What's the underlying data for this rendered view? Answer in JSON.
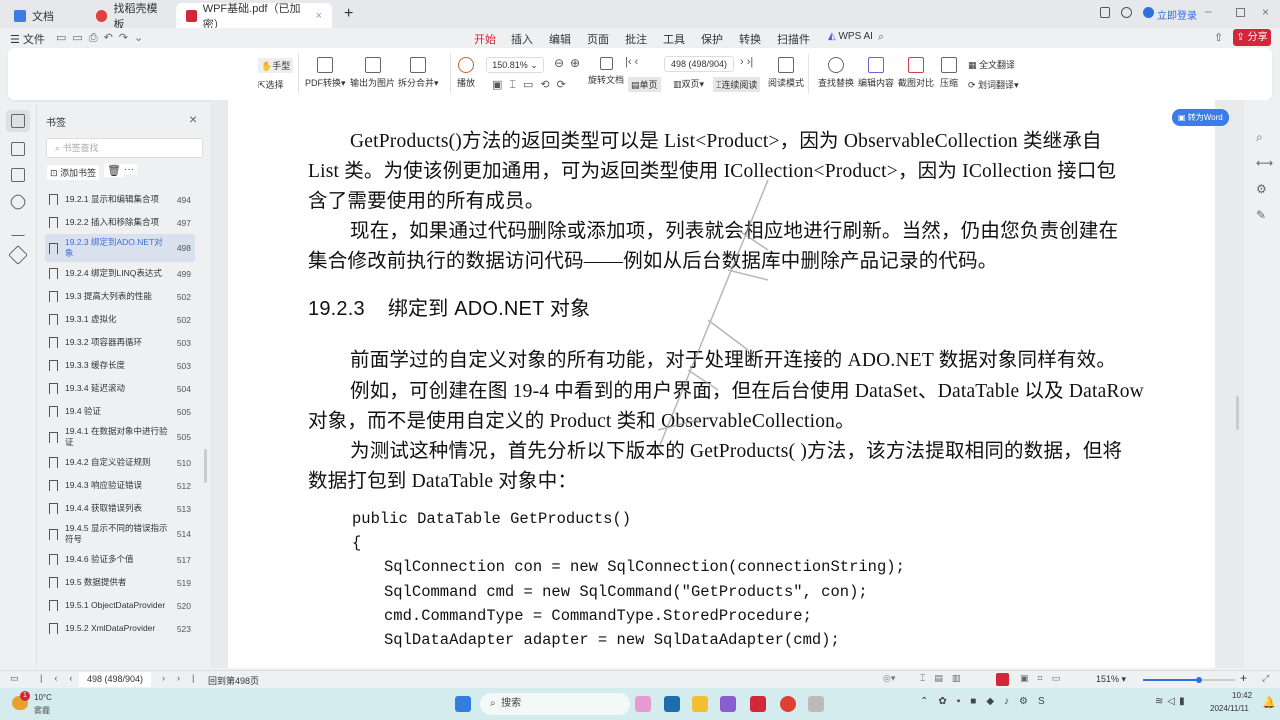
{
  "tabs": [
    {
      "label": "文档",
      "color": "#3d7be0"
    },
    {
      "label": "找稻壳模板",
      "color": "#e0413d"
    },
    {
      "label": "WPF基础.pdf（已加密）",
      "color": "#d0273b"
    }
  ],
  "menu": {
    "file": "文件",
    "items": [
      "开始",
      "插入",
      "编辑",
      "页面",
      "批注",
      "工具",
      "保护",
      "转换",
      "扫描件"
    ],
    "active": "开始",
    "ai": "WPS AI",
    "login": "立即登录",
    "share": "分享"
  },
  "ribbon": {
    "hand": "手型",
    "select": "选择",
    "pdf_convert": "PDF转换",
    "export_image": "输出为图片",
    "split_merge": "拆分合并",
    "play": "播放",
    "zoom": "150.81%",
    "rotate": "旋转文档",
    "single": "单页",
    "double": "双页",
    "continuous": "连续阅读",
    "read_mode": "阅读模式",
    "page_input": "498 (498/904)",
    "find_replace": "查找替换",
    "edit_content": "编辑内容",
    "screenshot_compare": "截图对比",
    "compress": "压缩",
    "full_translate": "全文翻译",
    "word_translate": "划词翻译"
  },
  "sidebar": {
    "title": "书签",
    "search_placeholder": "书签查找",
    "add": "添加书签",
    "more": "···",
    "items": [
      {
        "label": "19.2.1 显示和编辑集合项",
        "page": "494"
      },
      {
        "label": "19.2.2 插入和移除集合项",
        "page": "497"
      },
      {
        "label": "19.2.3 绑定到ADO.NET对象",
        "page": "498",
        "selected": true
      },
      {
        "label": "19.2.4 绑定到LINQ表达式",
        "page": "499"
      },
      {
        "label": "19.3 提高大列表的性能",
        "page": "502"
      },
      {
        "label": "19.3.1 虚拟化",
        "page": "502"
      },
      {
        "label": "19.3.2 项容器再循环",
        "page": "503"
      },
      {
        "label": "19.3.3 缓存长度",
        "page": "503"
      },
      {
        "label": "19.3.4 延迟滚动",
        "page": "504"
      },
      {
        "label": "19.4 验证",
        "page": "505"
      },
      {
        "label": "19.4.1 在数据对象中进行验证",
        "page": "505"
      },
      {
        "label": "19.4.2 自定义验证规则",
        "page": "510"
      },
      {
        "label": "19.4.3 响应验证错误",
        "page": "512"
      },
      {
        "label": "19.4.4 获取错误列表",
        "page": "513"
      },
      {
        "label": "19.4.5 显示不同的错误指示符号",
        "page": "514"
      },
      {
        "label": "19.4.6 验证多个值",
        "page": "517"
      },
      {
        "label": "19.5 数据提供者",
        "page": "519"
      },
      {
        "label": "19.5.1 ObjectDataProvider",
        "page": "520"
      },
      {
        "label": "19.5.2 XmlDataProvider",
        "page": "523"
      }
    ]
  },
  "to_word": "转为Word",
  "document": {
    "lines": [
      "GetProducts()方法的返回类型可以是 List<Product>，因为 ObservableCollection 类继承自",
      "List 类。为使该例更加通用，可为返回类型使用 ICollection<Product>，因为 ICollection 接口包",
      "含了需要使用的所有成员。",
      "现在，如果通过代码删除或添加项，列表就会相应地进行刷新。当然，仍由您负责创建在",
      "集合修改前执行的数据访问代码——例如从后台数据库中删除产品记录的代码。"
    ],
    "heading": "19.2.3    绑定到 ADO.NET 对象",
    "lines2": [
      "前面学过的自定义对象的所有功能，对于处理断开连接的 ADO.NET 数据对象同样有效。",
      "例如，可创建在图 19-4 中看到的用户界面，但在后台使用 DataSet、DataTable 以及 DataRow",
      "对象，而不是使用自定义的 Product 类和 ObservableCollection。",
      "为测试这种情况，首先分析以下版本的 GetProducts( )方法，该方法提取相同的数据，但将",
      "数据打包到 DataTable 对象中："
    ],
    "code": [
      "public DataTable GetProducts()",
      "{",
      "SqlConnection con = new SqlConnection(connectionString);",
      "SqlCommand cmd = new SqlCommand(\"GetProducts\", con);",
      "cmd.CommandType = CommandType.StoredProcedure;",
      "SqlDataAdapter adapter = new SqlDataAdapter(cmd);"
    ]
  },
  "status": {
    "page": "498 (498/904)",
    "back": "回到第498页",
    "zoom": "151%"
  },
  "taskbar": {
    "temp": "10°C",
    "weather": "雾霾",
    "badge": "1",
    "search": "搜索",
    "time": "10:42",
    "date": "2024/11/11"
  }
}
